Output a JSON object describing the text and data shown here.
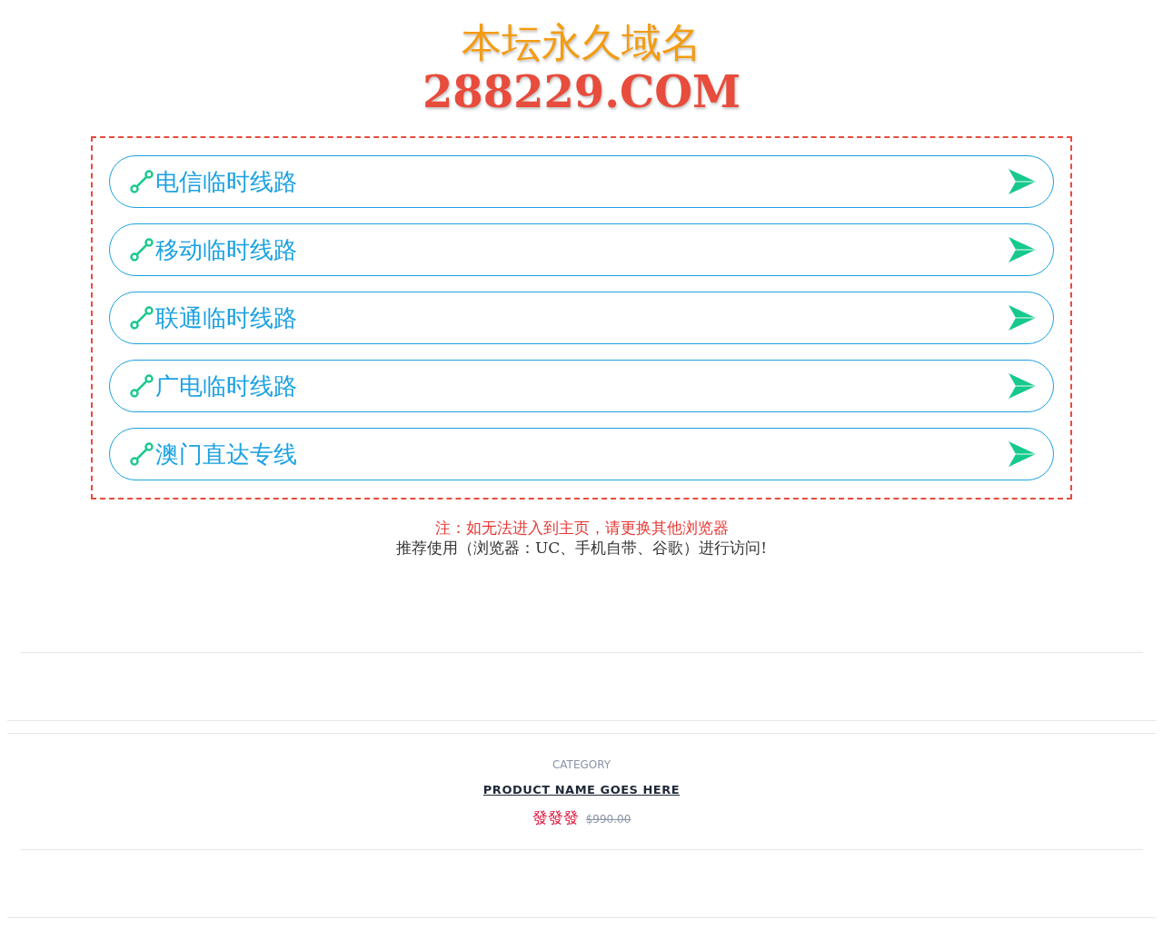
{
  "header": {
    "title": "本坛永久域名",
    "domain": "288229.COM"
  },
  "lines": [
    {
      "label": "电信临时线路"
    },
    {
      "label": "移动临时线路"
    },
    {
      "label": "联通临时线路"
    },
    {
      "label": "广电临时线路"
    },
    {
      "label": "澳门直达专线"
    }
  ],
  "notice": {
    "warning": "注：如无法进入到主页，请更换其他浏览器",
    "recommend": "推荐使用（浏览器：UC、手机自带、谷歌）进行访问!"
  },
  "product": {
    "category": "CATEGORY",
    "name": "PRODUCT NAME GOES HERE",
    "price": "發發發",
    "old_price": "$990.00"
  }
}
